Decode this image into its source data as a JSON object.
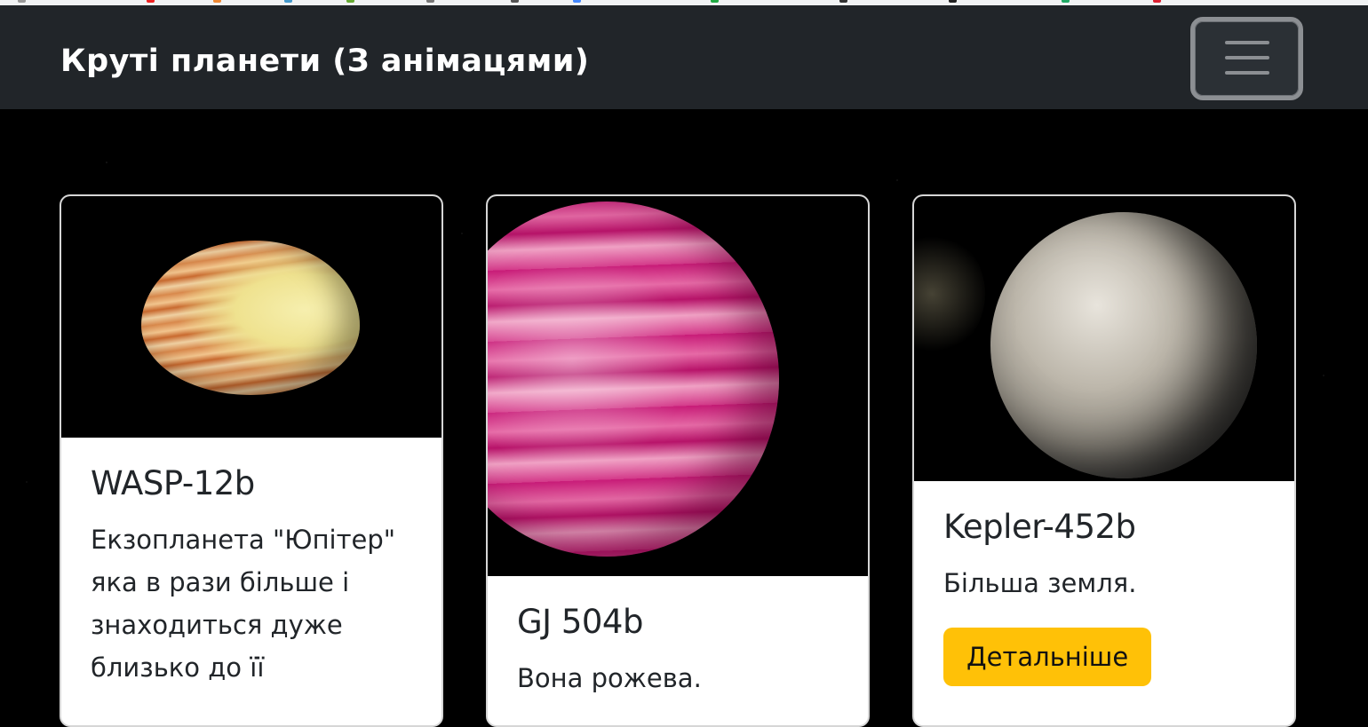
{
  "navbar": {
    "brand": "Круті планети (З анімацями)"
  },
  "cards": [
    {
      "title": "WASP-12b",
      "text": "Екзопланета \"Юпітер\" яка в рази більше і знаходиться дуже близько до її"
    },
    {
      "title": "GJ 504b",
      "text": "Вона рожева."
    },
    {
      "title": "Kepler-452b",
      "text": "Більша земля.",
      "button": "Детальніше"
    }
  ],
  "colors": {
    "navbar_bg": "#212529",
    "button_bg": "#ffc107",
    "toggler_border": "#8c8f93"
  },
  "icons": {
    "toggler": "hamburger-menu-icon"
  }
}
